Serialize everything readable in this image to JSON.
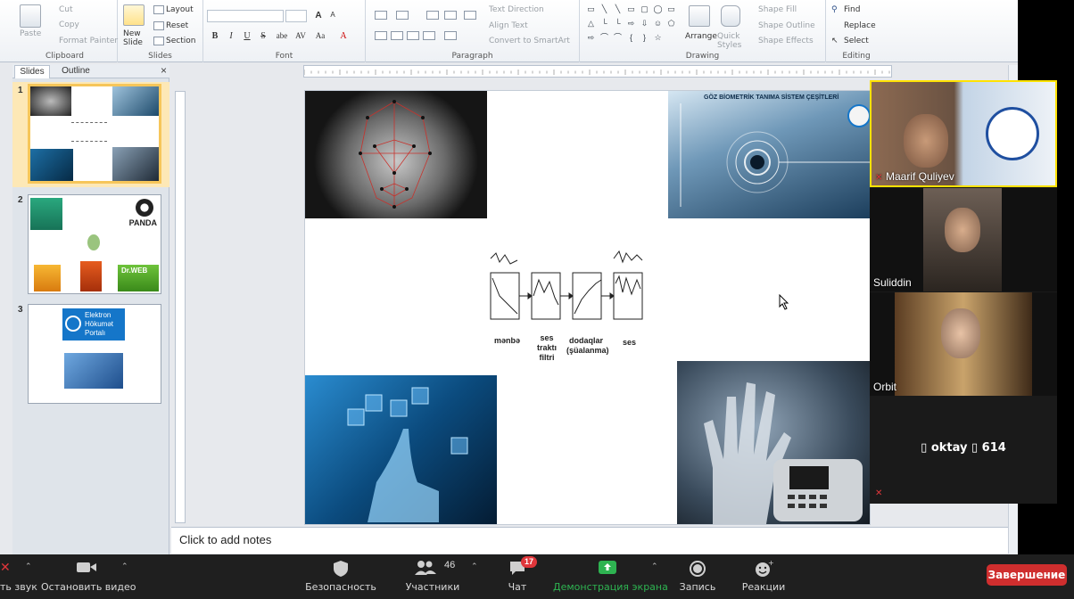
{
  "ribbon": {
    "clipboard": {
      "label": "Clipboard",
      "paste": "Paste",
      "cut": "Cut",
      "copy": "Copy",
      "format_painter": "Format Painter"
    },
    "slides": {
      "label": "Slides",
      "new_slide": "New Slide",
      "layout": "Layout",
      "reset": "Reset",
      "section": "Section"
    },
    "font": {
      "label": "Font",
      "bold": "B",
      "italic": "I",
      "underline": "U",
      "strike": "S",
      "shadow": "abe",
      "spacing": "AV",
      "case": "Aa",
      "color": "A"
    },
    "paragraph": {
      "label": "Paragraph",
      "text_direction": "Text Direction",
      "align_text": "Align Text",
      "convert_smartart": "Convert to SmartArt"
    },
    "drawing": {
      "label": "Drawing",
      "arrange": "Arrange",
      "quick_styles": "Quick Styles",
      "shape_fill": "Shape Fill",
      "shape_outline": "Shape Outline",
      "shape_effects": "Shape Effects"
    },
    "editing": {
      "label": "Editing",
      "find": "Find",
      "replace": "Replace",
      "select": "Select"
    }
  },
  "panel": {
    "tabs": [
      "Slides",
      "Outline"
    ],
    "close": "×",
    "slide_numbers": [
      "1",
      "2",
      "3"
    ],
    "thumb2_brand": "PANDA",
    "thumb2_brand2": "Dr.WEB",
    "thumb3_text": [
      "Elektron",
      "Hökumət",
      "Portalı"
    ]
  },
  "slide": {
    "banner": "GÖZ BİOMETRİK TANIMA SİSTEM ÇEŞİTLERİ",
    "diagram_labels": [
      "mənbə",
      "ses traktı filtri",
      "dodaqlar (şüalanma)",
      "ses"
    ]
  },
  "notes": {
    "placeholder": "Click to add notes"
  },
  "participants": [
    {
      "name": "Maarif Quliyev",
      "muted": true
    },
    {
      "name": "Suliddin",
      "muted": false
    },
    {
      "name": "Orbit",
      "muted": false
    },
    {
      "name": "▯ oktay ▯ 614",
      "muted": true
    }
  ],
  "toolbar": {
    "audio": "ть звук",
    "video": "Остановить видео",
    "security": "Безопасность",
    "participants": "Участники",
    "participants_count": "46",
    "chat": "Чат",
    "chat_badge": "17",
    "share": "Демонстрация экрана",
    "record": "Запись",
    "reactions": "Реакции",
    "end": "Завершение"
  },
  "colors": {
    "share_green": "#2eb351",
    "end_red": "#cf2e2e",
    "toolbar_bg": "#1f1f1f"
  }
}
